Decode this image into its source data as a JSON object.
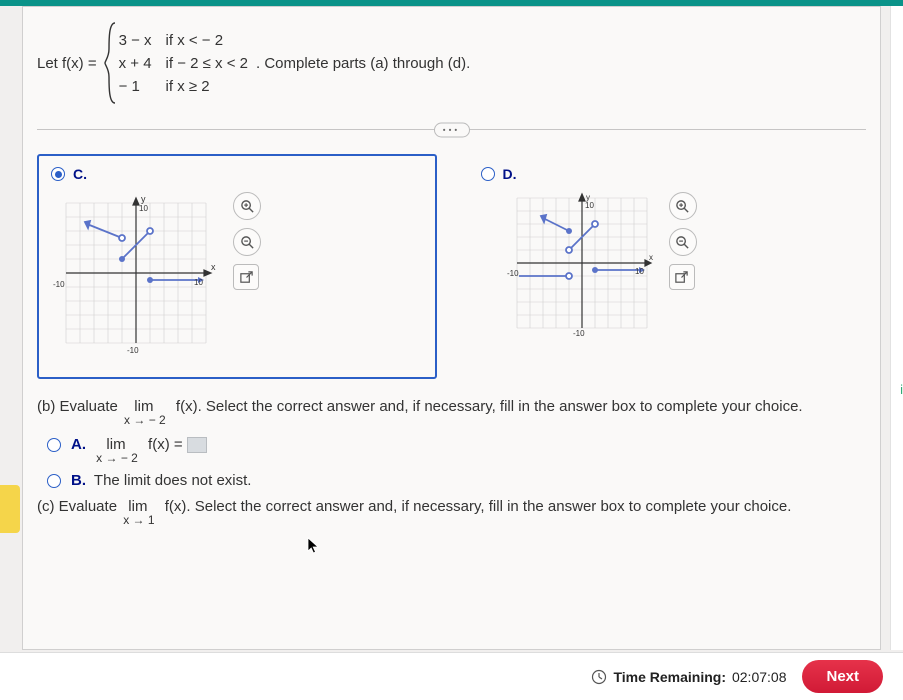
{
  "header": {
    "let_label": "Let f(x) =",
    "after_text": ". Complete parts (a) through (d).",
    "pieces": [
      {
        "expr": "3 − x",
        "cond": "if x < − 2"
      },
      {
        "expr": "x + 4",
        "cond": "if − 2 ≤ x < 2"
      },
      {
        "expr": "− 1",
        "cond": "if x ≥ 2"
      }
    ]
  },
  "choices": {
    "c_label": "C.",
    "d_label": "D."
  },
  "graph": {
    "y_label": "y",
    "x_label": "x",
    "tick_neg10": "-10",
    "tick_pos10": "10"
  },
  "part_b": {
    "prompt_prefix": "(b) Evaluate ",
    "lim_top": "lim",
    "sub": "x → − 2",
    "fx": "f(x).",
    "prompt_suffix": " Select the correct answer and, if necessary, fill in the answer box to complete your choice."
  },
  "opt_a": {
    "label": "A.",
    "lim_top": "lim",
    "sub": "x → − 2",
    "expr": "f(x) ="
  },
  "opt_b": {
    "label": "B.",
    "text": "The limit does not exist."
  },
  "part_c": {
    "prompt_prefix": "(c) Evaluate ",
    "lim_top": "lim",
    "sub": "x → 1",
    "fx": "f(x).",
    "prompt_suffix": " Select the correct answer and, if necessary, fill in the answer box to complete your choice."
  },
  "footer": {
    "time_label": "Time Remaining:",
    "time_value": "02:07:08",
    "next": "Next"
  },
  "icons": {
    "zoom_in": "zoom-in-icon",
    "zoom_out": "zoom-out-icon",
    "popout": "popout-icon",
    "clock": "clock-icon"
  }
}
